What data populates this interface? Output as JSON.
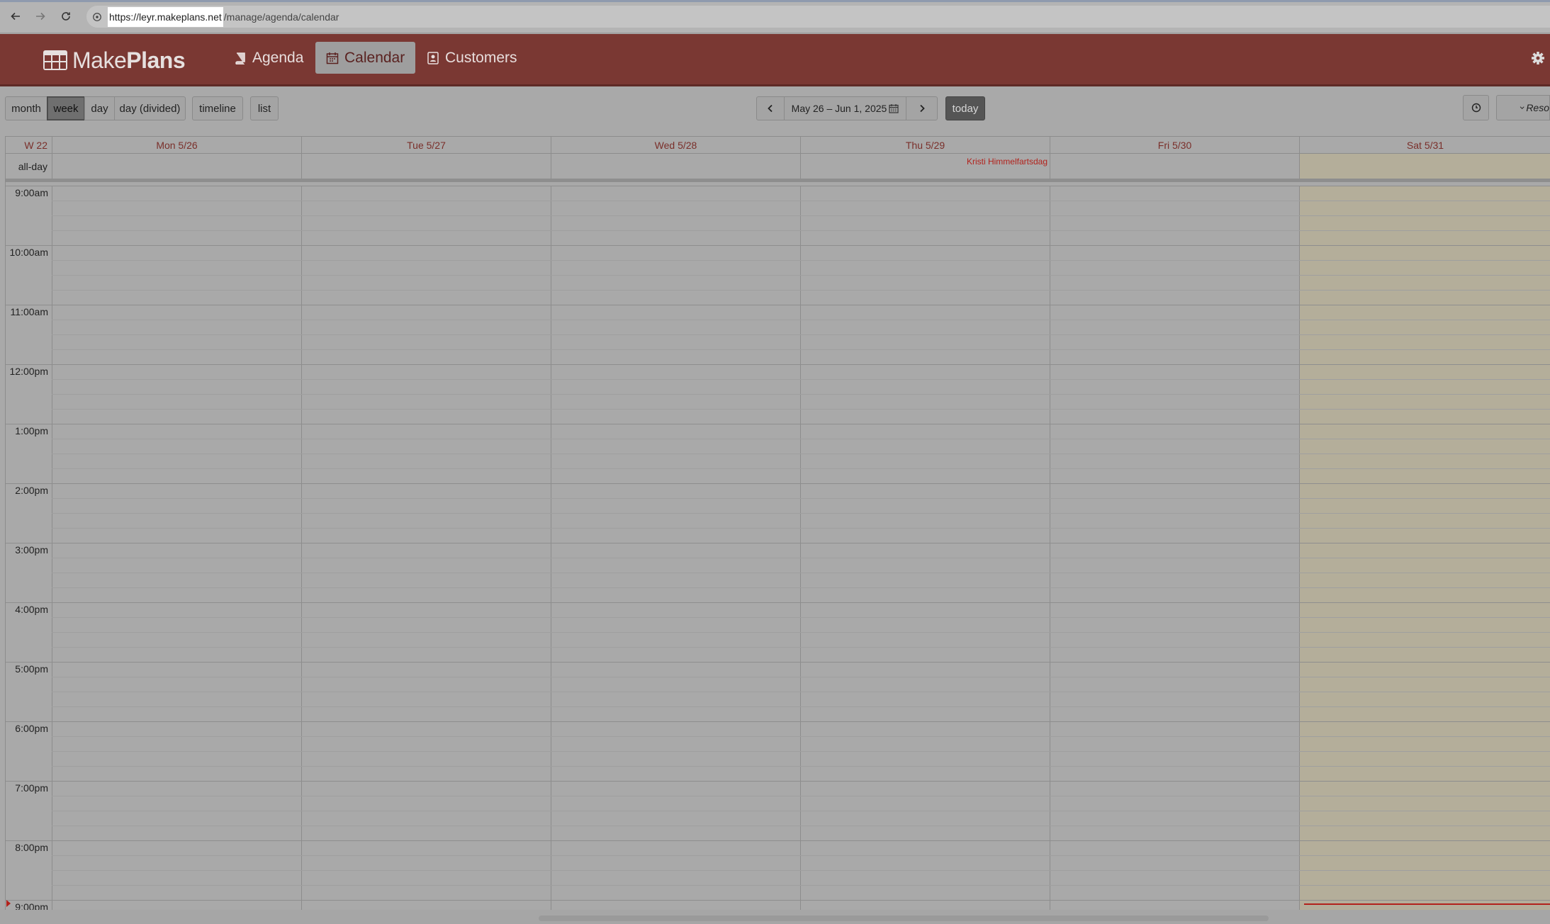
{
  "browser": {
    "url_selected": "https://leyr.makeplans.net",
    "url_rest": "/manage/agenda/calendar"
  },
  "app": {
    "logo_light": "Make",
    "logo_bold": "Plans",
    "tabs": [
      {
        "label": "Agenda",
        "icon": "book-icon"
      },
      {
        "label": "Calendar",
        "icon": "calendar-icon",
        "active": true
      },
      {
        "label": "Customers",
        "icon": "contact-card-icon"
      }
    ]
  },
  "toolbar": {
    "views": [
      "month",
      "week",
      "day",
      "day (divided)"
    ],
    "active_view": "week",
    "timeline": "timeline",
    "list": "list",
    "date_range": "May 26 – Jun 1, 2025",
    "today": "today",
    "resources_label": "Reso"
  },
  "calendar": {
    "week_label": "W 22",
    "all_day_label": "all-day",
    "days": [
      "Mon 5/26",
      "Tue 5/27",
      "Wed 5/28",
      "Thu 5/29",
      "Fri 5/30",
      "Sat 5/31"
    ],
    "all_day_events": [
      {
        "day": "Thu 5/29",
        "title": "Kristi Himmelfartsdag"
      }
    ],
    "times": [
      "9:00am",
      "10:00am",
      "11:00am",
      "12:00pm",
      "1:00pm",
      "2:00pm",
      "3:00pm",
      "4:00pm",
      "5:00pm",
      "6:00pm",
      "7:00pm",
      "8:00pm",
      "9:00pm"
    ]
  },
  "colors": {
    "brand": "#7a3833",
    "event_text": "#b2221c",
    "today_column": "#b4ae9a"
  }
}
